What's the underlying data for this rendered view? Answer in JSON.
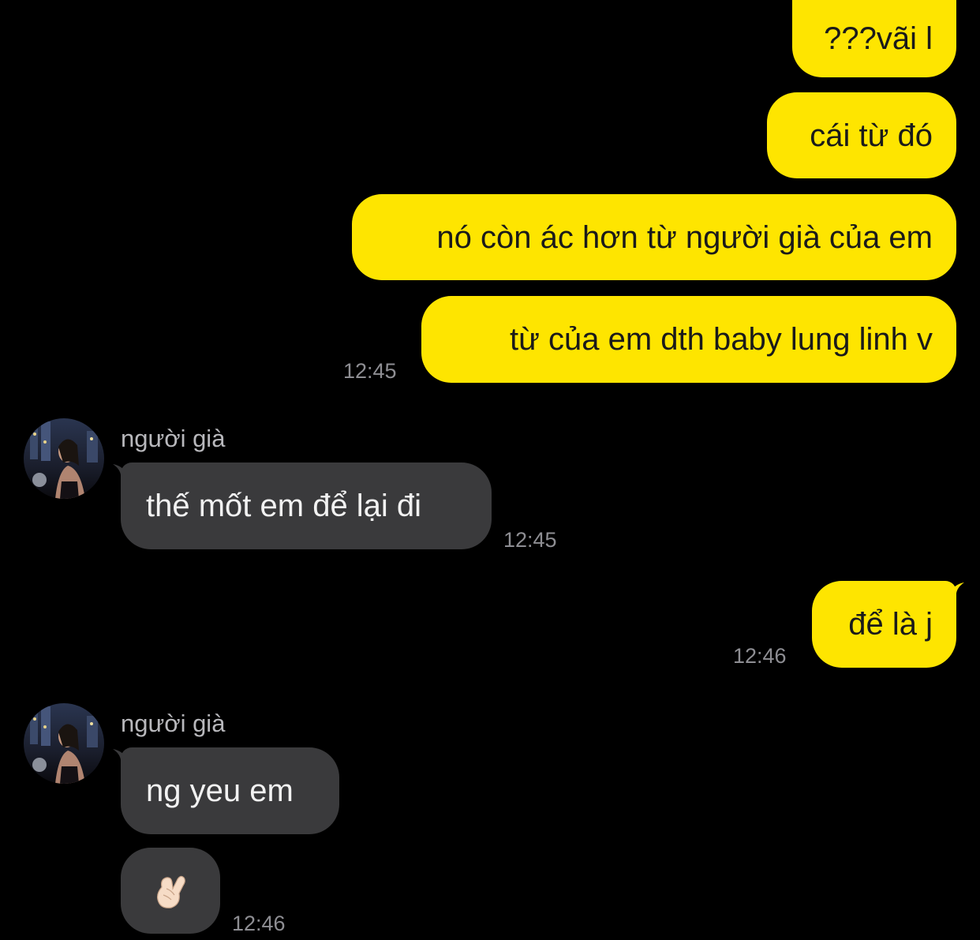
{
  "colors": {
    "background": "#000000",
    "outgoing_bubble": "#FEE500",
    "incoming_bubble": "#3a3a3c",
    "timestamp": "#8e8e93"
  },
  "messages": [
    {
      "direction": "outgoing",
      "text": "???vãi l"
    },
    {
      "direction": "outgoing",
      "text": "cái từ đó"
    },
    {
      "direction": "outgoing",
      "text": "nó còn ác hơn từ người già của em"
    },
    {
      "direction": "outgoing",
      "text": "từ của em dth baby lung linh v",
      "time": "12:45"
    },
    {
      "direction": "incoming",
      "sender": "người già",
      "text": "thế mốt em để lại đi",
      "time": "12:45"
    },
    {
      "direction": "outgoing",
      "text": "để là j",
      "time": "12:46"
    },
    {
      "direction": "incoming",
      "sender": "người già",
      "text": "ng yeu em"
    },
    {
      "direction": "incoming",
      "emoji": "finger-heart-emoji-icon",
      "time": "12:46"
    }
  ]
}
